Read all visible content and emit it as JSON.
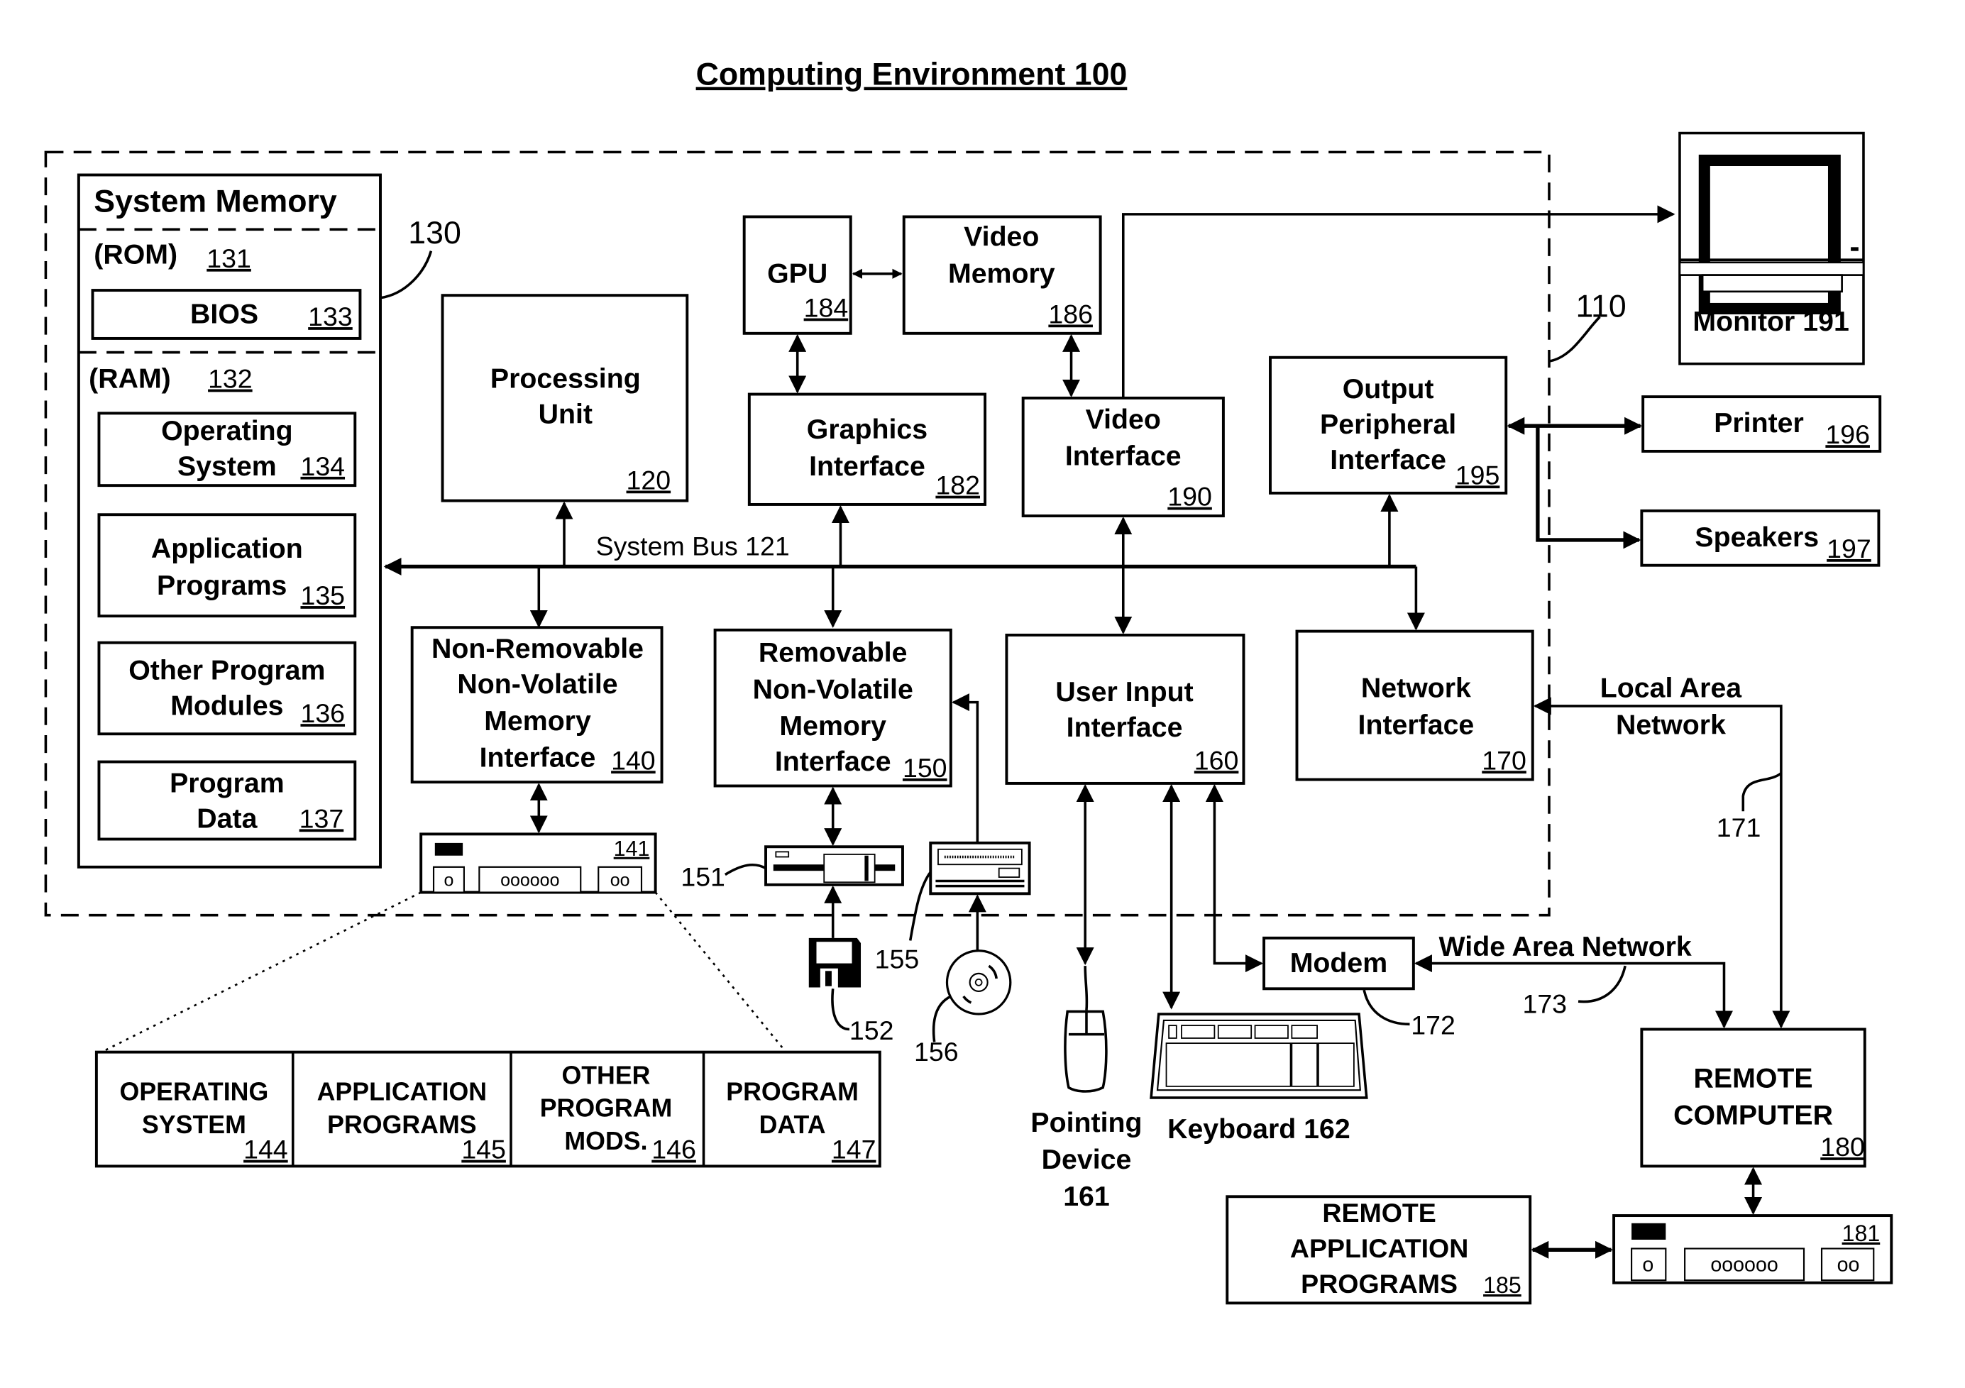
{
  "title": "Computing Environment 100",
  "refs": {
    "computer": "110",
    "system_memory": "130",
    "lan": "171",
    "modem_ref": "172",
    "wan": "173",
    "floppy_drive": "151",
    "floppy_disk": "152",
    "cd_drive": "155",
    "cd_disk": "156"
  },
  "system_memory": {
    "title": "System Memory",
    "rom_label": "(ROM)",
    "rom_num": "131",
    "bios_label": "BIOS",
    "bios_num": "133",
    "ram_label": "(RAM)",
    "ram_num": "132",
    "items": [
      {
        "line1": "Operating",
        "line2": "System",
        "num": "134"
      },
      {
        "line1": "Application",
        "line2": "Programs",
        "num": "135"
      },
      {
        "line1": "Other Program",
        "line2": "Modules",
        "num": "136"
      },
      {
        "line1": "Program",
        "line2": "Data",
        "num": "137"
      }
    ]
  },
  "processing_unit": {
    "line1": "Processing",
    "line2": "Unit",
    "num": "120"
  },
  "gpu": {
    "label": "GPU",
    "num": "184"
  },
  "video_memory": {
    "line1": "Video",
    "line2": "Memory",
    "num": "186"
  },
  "graphics_interface": {
    "line1": "Graphics",
    "line2": "Interface",
    "num": "182"
  },
  "video_interface": {
    "line1": "Video",
    "line2": "Interface",
    "num": "190"
  },
  "output_peripheral": {
    "line1": "Output",
    "line2": "Peripheral",
    "line3": "Interface",
    "num": "195"
  },
  "system_bus": "System Bus 121",
  "nonremovable": {
    "line1": "Non-Removable",
    "line2": "Non-Volatile",
    "line3": "Memory",
    "line4": "Interface",
    "num": "140"
  },
  "removable": {
    "line1": "Removable",
    "line2": "Non-Volatile",
    "line3": "Memory",
    "line4": "Interface",
    "num": "150"
  },
  "user_input": {
    "line1": "User Input",
    "line2": "Interface",
    "num": "160"
  },
  "network_interface": {
    "line1": "Network",
    "line2": "Interface",
    "num": "170"
  },
  "hard_disk": {
    "num": "141",
    "slot_a": "o",
    "slot_b": "oooooo",
    "slot_c": "oo"
  },
  "stored": [
    {
      "line1": "OPERATING",
      "line2": "SYSTEM",
      "line3": "",
      "num": "144"
    },
    {
      "line1": "APPLICATION",
      "line2": "PROGRAMS",
      "line3": "",
      "num": "145"
    },
    {
      "line1": "OTHER",
      "line2": "PROGRAM",
      "line3": "MODS.",
      "num": "146"
    },
    {
      "line1": "PROGRAM",
      "line2": "DATA",
      "line3": "",
      "num": "147"
    }
  ],
  "monitor": {
    "label": "Monitor 191"
  },
  "printer": {
    "label": "Printer",
    "num": "196"
  },
  "speakers": {
    "label": "Speakers",
    "num": "197"
  },
  "lan_label": {
    "line1": "Local Area",
    "line2": "Network"
  },
  "wan_label": "Wide Area Network",
  "modem": {
    "label": "Modem"
  },
  "pointing": {
    "line1": "Pointing",
    "line2": "Device",
    "line3": "161"
  },
  "keyboard": {
    "label": "Keyboard 162"
  },
  "remote_computer": {
    "line1": "REMOTE",
    "line2": "COMPUTER",
    "num": "180"
  },
  "remote_apps": {
    "line1": "REMOTE",
    "line2": "APPLICATION",
    "line3": "PROGRAMS",
    "num": "185"
  },
  "remote_disk": {
    "num": "181",
    "slot_a": "o",
    "slot_b": "oooooo",
    "slot_c": "oo"
  }
}
